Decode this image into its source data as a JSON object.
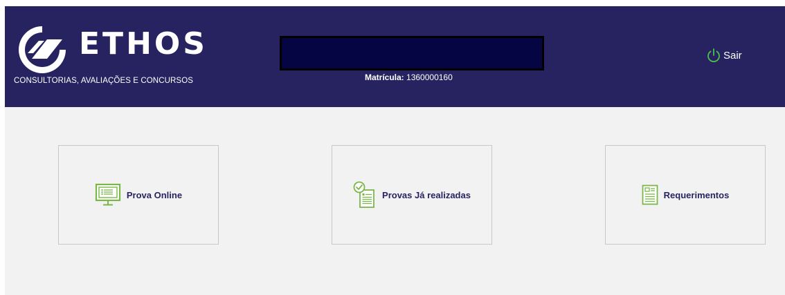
{
  "header": {
    "logo": {
      "name": "ETHOS",
      "tagline": "CONSULTORIAS, AVALIAÇÕES E CONCURSOS"
    },
    "user": {
      "name_redacted": "",
      "matricula_label": "Matrícula:",
      "matricula_value": "1360000160"
    },
    "logout_label": "Sair",
    "logout_icon": "power-icon"
  },
  "cards": [
    {
      "label": "Prova Online",
      "icon": "monitor-icon"
    },
    {
      "label": "Provas Já realizadas",
      "icon": "checked-document-icon"
    },
    {
      "label": "Requerimentos",
      "icon": "form-document-icon"
    }
  ],
  "colors": {
    "header_bg": "#272360",
    "content_bg": "#f2f2f2",
    "accent_green": "#7ab648",
    "logout_green": "#4cc24c",
    "card_text": "#272360"
  }
}
